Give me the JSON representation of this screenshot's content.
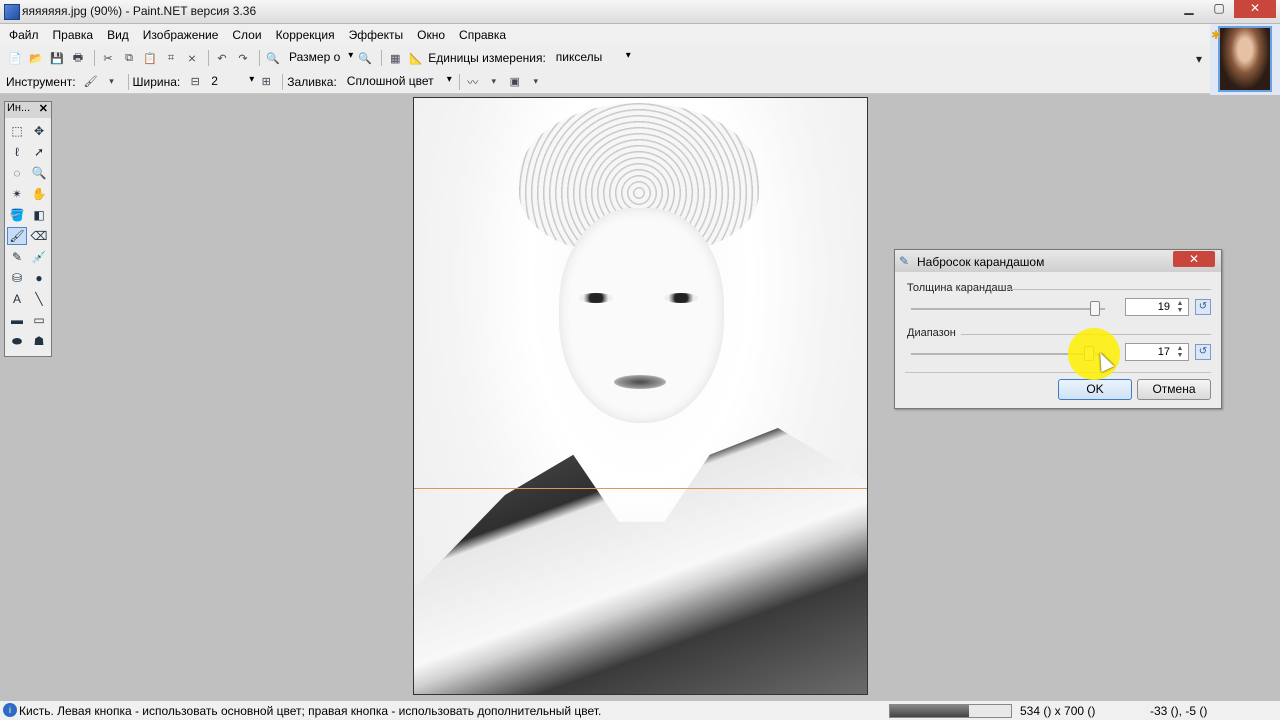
{
  "window": {
    "title": "яяяяяяя.jpg (90%) - Paint.NET версия 3.36",
    "min": "▁",
    "max": "▢",
    "close": "✕"
  },
  "menu": [
    "Файл",
    "Правка",
    "Вид",
    "Изображение",
    "Слои",
    "Коррекция",
    "Эффекты",
    "Окно",
    "Справка"
  ],
  "toolbar": {
    "zoom_label": "Размер о",
    "units_label": "Единицы измерения:",
    "units_value": "пикселы",
    "tool_label": "Инструмент:",
    "width_label": "Ширина:",
    "width_value": "2",
    "fill_label": "Заливка:",
    "fill_value": "Сплошной цвет"
  },
  "tools_panel": {
    "title": "Ин...",
    "close": "✕"
  },
  "dialog": {
    "title": "Набросок карандашом",
    "close": "✕",
    "param1_label": "Толщина карандаша",
    "param1_value": "19",
    "param1_fraction": 0.95,
    "param2_label": "Диапазон",
    "param2_value": "17",
    "param2_fraction": 0.92,
    "ok": "OK",
    "cancel": "Отмена"
  },
  "status": {
    "message": "Кисть. Левая кнопка - использовать основной цвет; правая кнопка - использовать дополнительный цвет.",
    "progress_fraction": 0.65,
    "size": "534 () x 700 ()",
    "cursor": "-33 (), -5 ()"
  },
  "colors": {
    "accent": "#3d7bc4",
    "close_red": "#c9463d",
    "highlight": "#fff000"
  },
  "icons": [
    "new-icon",
    "open-icon",
    "save-icon",
    "print-icon",
    "cut-icon",
    "copy-icon",
    "paste-icon",
    "crop-icon",
    "deselect-icon",
    "undo-icon",
    "redo-icon",
    "zoom-out-icon",
    "zoom-in-icon",
    "grid-icon",
    "brush-icon",
    "antialias-icon",
    "blend-icon"
  ]
}
